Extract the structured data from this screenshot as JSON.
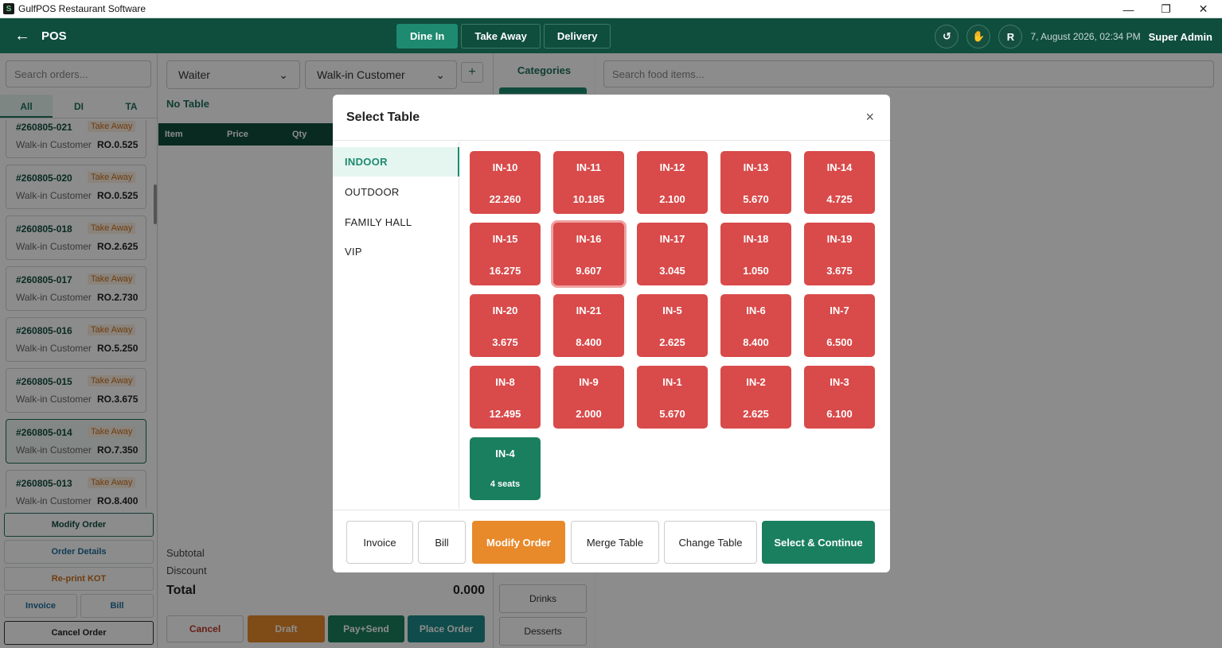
{
  "window": {
    "title": "GulfPOS Restaurant Software",
    "icon": "S",
    "minimize": "—",
    "maximize": "❐",
    "close": "✕"
  },
  "header": {
    "back": "←",
    "title": "POS",
    "modes": [
      "Dine In",
      "Take Away",
      "Delivery"
    ],
    "refresh": "↺",
    "hand": "✋",
    "avatar": "R",
    "datetime": "7, August 2026, 02:34 PM",
    "user": "Super Admin"
  },
  "left": {
    "search_placeholder": "Search orders...",
    "tabs": [
      "All",
      "DI",
      "TA"
    ],
    "orders": [
      {
        "no": "#260805-021",
        "type": "Take Away",
        "customer": "Walk-in Customer",
        "amount": "RO.0.525"
      },
      {
        "no": "#260805-020",
        "type": "Take Away",
        "customer": "Walk-in Customer",
        "amount": "RO.0.525"
      },
      {
        "no": "#260805-018",
        "type": "Take Away",
        "customer": "Walk-in Customer",
        "amount": "RO.2.625"
      },
      {
        "no": "#260805-017",
        "type": "Take Away",
        "customer": "Walk-in Customer",
        "amount": "RO.2.730"
      },
      {
        "no": "#260805-016",
        "type": "Take Away",
        "customer": "Walk-in Customer",
        "amount": "RO.5.250"
      },
      {
        "no": "#260805-015",
        "type": "Take Away",
        "customer": "Walk-in Customer",
        "amount": "RO.3.675"
      },
      {
        "no": "#260805-014",
        "type": "Take Away",
        "customer": "Walk-in Customer",
        "amount": "RO.7.350"
      },
      {
        "no": "#260805-013",
        "type": "Take Away",
        "customer": "Walk-in Customer",
        "amount": "RO.8.400"
      }
    ],
    "buttons": {
      "modify": "Modify Order",
      "details": "Order Details",
      "reprint": "Re-print KOT",
      "invoice": "Invoice",
      "bill": "Bill",
      "cancel": "Cancel Order"
    }
  },
  "center": {
    "waiter": "Waiter",
    "customer": "Walk-in Customer",
    "plus": "+",
    "table_status": "No Table",
    "columns": [
      "Item",
      "Price",
      "Qty"
    ],
    "subtotal_label": "Subtotal",
    "discount_label": "Discount",
    "total_label": "Total",
    "total_value": "0.000",
    "buttons": {
      "cancel": "Cancel",
      "draft": "Draft",
      "pay_send": "Pay+Send",
      "place": "Place Order"
    }
  },
  "categories": {
    "title": "Categories",
    "items": [
      "Drinks",
      "Desserts"
    ]
  },
  "food": {
    "search_placeholder": "Search food items..."
  },
  "modal": {
    "title": "Select Table",
    "close": "×",
    "areas": [
      "INDOOR",
      "OUTDOOR",
      "FAMILY HALL",
      "VIP"
    ],
    "tables": [
      {
        "name": "IN-10",
        "value": "22.260",
        "status": "occupied"
      },
      {
        "name": "IN-11",
        "value": "10.185",
        "status": "occupied"
      },
      {
        "name": "IN-12",
        "value": "2.100",
        "status": "occupied"
      },
      {
        "name": "IN-13",
        "value": "5.670",
        "status": "occupied"
      },
      {
        "name": "IN-14",
        "value": "4.725",
        "status": "occupied"
      },
      {
        "name": "IN-15",
        "value": "16.275",
        "status": "occupied"
      },
      {
        "name": "IN-16",
        "value": "9.607",
        "status": "selected"
      },
      {
        "name": "IN-17",
        "value": "3.045",
        "status": "occupied"
      },
      {
        "name": "IN-18",
        "value": "1.050",
        "status": "occupied"
      },
      {
        "name": "IN-19",
        "value": "3.675",
        "status": "occupied"
      },
      {
        "name": "IN-20",
        "value": "3.675",
        "status": "occupied"
      },
      {
        "name": "IN-21",
        "value": "8.400",
        "status": "occupied"
      },
      {
        "name": "IN-5",
        "value": "2.625",
        "status": "occupied"
      },
      {
        "name": "IN-6",
        "value": "8.400",
        "status": "occupied"
      },
      {
        "name": "IN-7",
        "value": "6.500",
        "status": "occupied"
      },
      {
        "name": "IN-8",
        "value": "12.495",
        "status": "occupied"
      },
      {
        "name": "IN-9",
        "value": "2.000",
        "status": "occupied"
      },
      {
        "name": "IN-1",
        "value": "5.670",
        "status": "occupied"
      },
      {
        "name": "IN-2",
        "value": "2.625",
        "status": "occupied"
      },
      {
        "name": "IN-3",
        "value": "6.100",
        "status": "occupied"
      },
      {
        "name": "IN-4",
        "value": "4 seats",
        "status": "available"
      }
    ],
    "footer": {
      "invoice": "Invoice",
      "bill": "Bill",
      "modify": "Modify Order",
      "merge": "Merge Table",
      "change": "Change Table",
      "select": "Select & Continue"
    }
  }
}
